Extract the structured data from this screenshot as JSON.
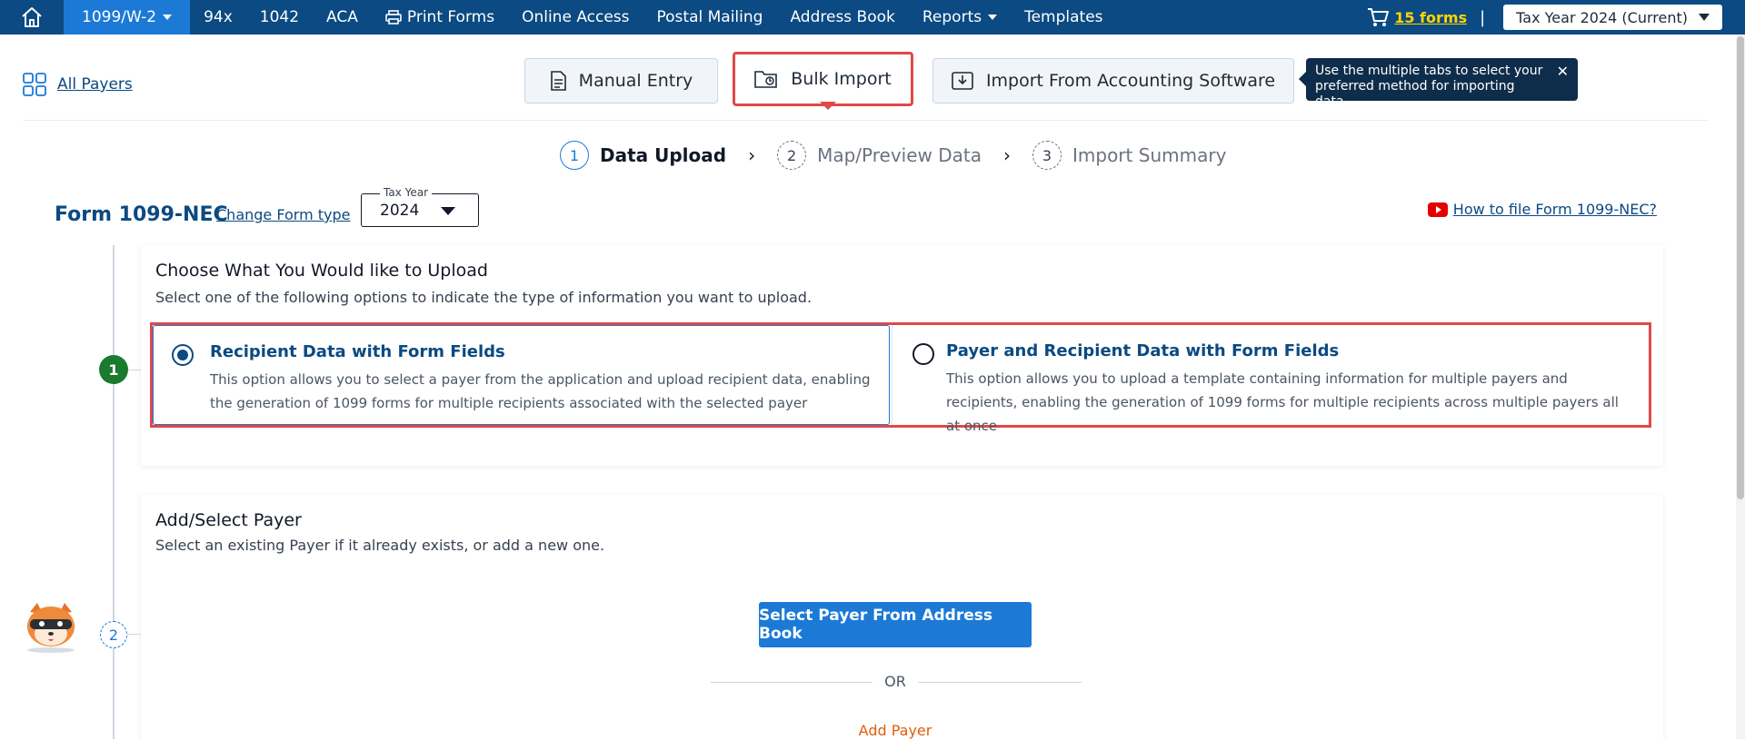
{
  "nav": {
    "items": [
      "1099/W-2",
      "94x",
      "1042",
      "ACA",
      "Print Forms",
      "Online Access",
      "Postal Mailing",
      "Address Book",
      "Reports",
      "Templates"
    ],
    "cart_label": "15 forms",
    "separator": "|",
    "tax_year": "Tax Year 2024 (Current)"
  },
  "subheader": {
    "all_payers": "All Payers",
    "tabs": {
      "manual": "Manual Entry",
      "bulk": "Bulk Import",
      "accounting": "Import From Accounting Software"
    },
    "tooltip": "Use the multiple tabs to select your preferred method for importing data.",
    "tooltip_close": "✕"
  },
  "stepper": {
    "steps": [
      {
        "num": "1",
        "label": "Data Upload"
      },
      {
        "num": "2",
        "label": "Map/Preview Data"
      },
      {
        "num": "3",
        "label": "Import Summary"
      }
    ],
    "arrow": "›"
  },
  "form": {
    "title": "Form 1099-NEC",
    "change_link": "Change Form type",
    "tax_year_legend": "Tax Year",
    "tax_year_value": "2024",
    "howto_link": "How to file Form 1099-NEC?"
  },
  "upload": {
    "step": "1",
    "title": "Choose What You Would like to Upload",
    "subtitle": "Select one of the following options to indicate the type of information you want to upload.",
    "options": [
      {
        "title": "Recipient Data with Form Fields",
        "desc": "This option allows you to select a payer from the application and upload recipient data, enabling the generation of 1099 forms for multiple recipients associated with the selected payer"
      },
      {
        "title": "Payer and Recipient Data with Form Fields",
        "desc": "This option allows you to upload a template containing information for multiple payers and recipients, enabling the generation of 1099 forms for multiple recipients across multiple payers all at once"
      }
    ]
  },
  "payer": {
    "step": "2",
    "title": "Add/Select Payer",
    "subtitle": "Select an existing Payer if it already exists, or add a new one.",
    "select_button": "Select Payer From Address Book",
    "or": "OR",
    "add_link": "Add Payer"
  },
  "colors": {
    "nav_bg": "#0b4a82",
    "nav_active": "#1c7ad6",
    "highlight": "#e24848",
    "step_done": "#1a7a2e",
    "link": "#0b4a82",
    "add_payer": "#e35d0b"
  }
}
